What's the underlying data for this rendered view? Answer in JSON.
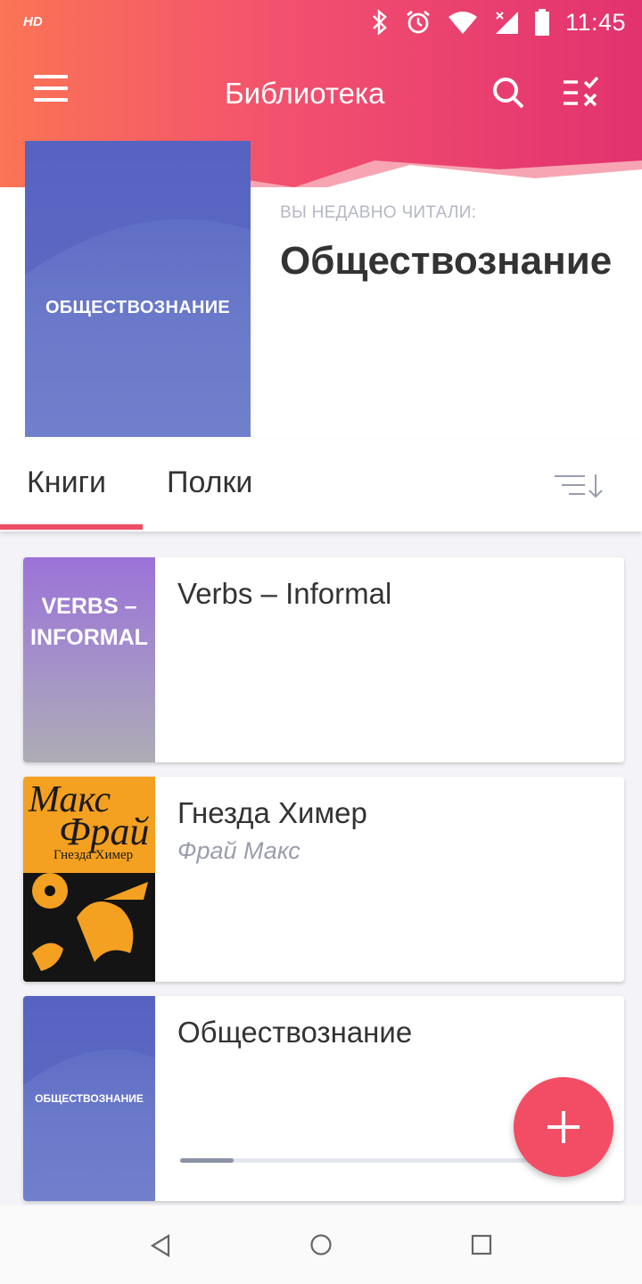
{
  "status_bar": {
    "hd": "HD",
    "time": "11:45",
    "icons": [
      "bluetooth-icon",
      "alarm-icon",
      "wifi-icon",
      "signal-icon",
      "battery-icon"
    ]
  },
  "toolbar": {
    "title": "Библиотека",
    "icons": [
      "menu-icon",
      "search-icon",
      "select-icon"
    ]
  },
  "recent": {
    "label": "ВЫ НЕДАВНО ЧИТАЛИ:",
    "title": "Обществознание",
    "cover_text": "ОБЩЕСТВОЗНАНИЕ"
  },
  "tabs": {
    "books": "Книги",
    "shelves": "Полки",
    "active": "books"
  },
  "books": [
    {
      "title": "Verbs – Informal",
      "author": "",
      "cover_text": "VERBS – INFORMAL"
    },
    {
      "title": "Гнезда Химер",
      "author": "Фрай Макс",
      "cover_text_1": "Макс",
      "cover_text_2": "Фрай",
      "cover_text_3": "Гнезда Химер"
    },
    {
      "title": "Обществознание",
      "author": "",
      "cover_text": "ОБЩЕСТВОЗНАНИЕ",
      "progress": 0.15
    }
  ],
  "colors": {
    "accent": "#f24d64",
    "tab_indicator": "#ee4d67",
    "header_start": "#fb7455",
    "header_end": "#e2326f"
  }
}
